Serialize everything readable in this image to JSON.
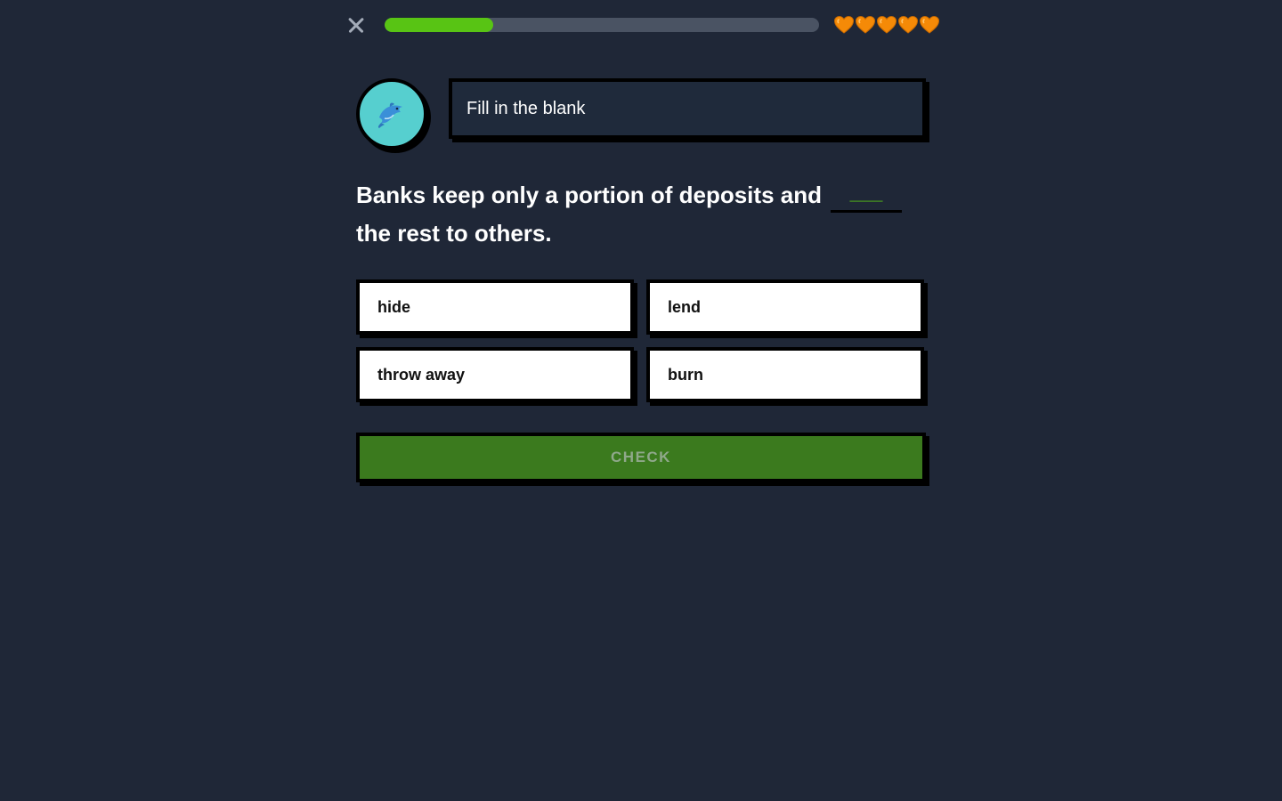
{
  "topbar": {
    "close_icon": "close-icon",
    "progress": 0.25,
    "lives": 5,
    "heart_icon": "orange-heart-icon"
  },
  "colors": {
    "background": "#1f2737",
    "progress_fill": "#58c414",
    "progress_track": "#4a5363",
    "heart": "#f58a07",
    "mascot_bg": "#56cfcf",
    "check_button": "#3b7a1e"
  },
  "mascot": {
    "icon": "dolphin-icon"
  },
  "prompt": {
    "label": "Fill in the blank"
  },
  "question": {
    "before": "Banks keep only a portion of deposits and",
    "blank": "___",
    "after": "the rest to others."
  },
  "options": [
    {
      "label": "hide"
    },
    {
      "label": "lend"
    },
    {
      "label": "throw away"
    },
    {
      "label": "burn"
    }
  ],
  "check_button": {
    "label": "CHECK"
  }
}
